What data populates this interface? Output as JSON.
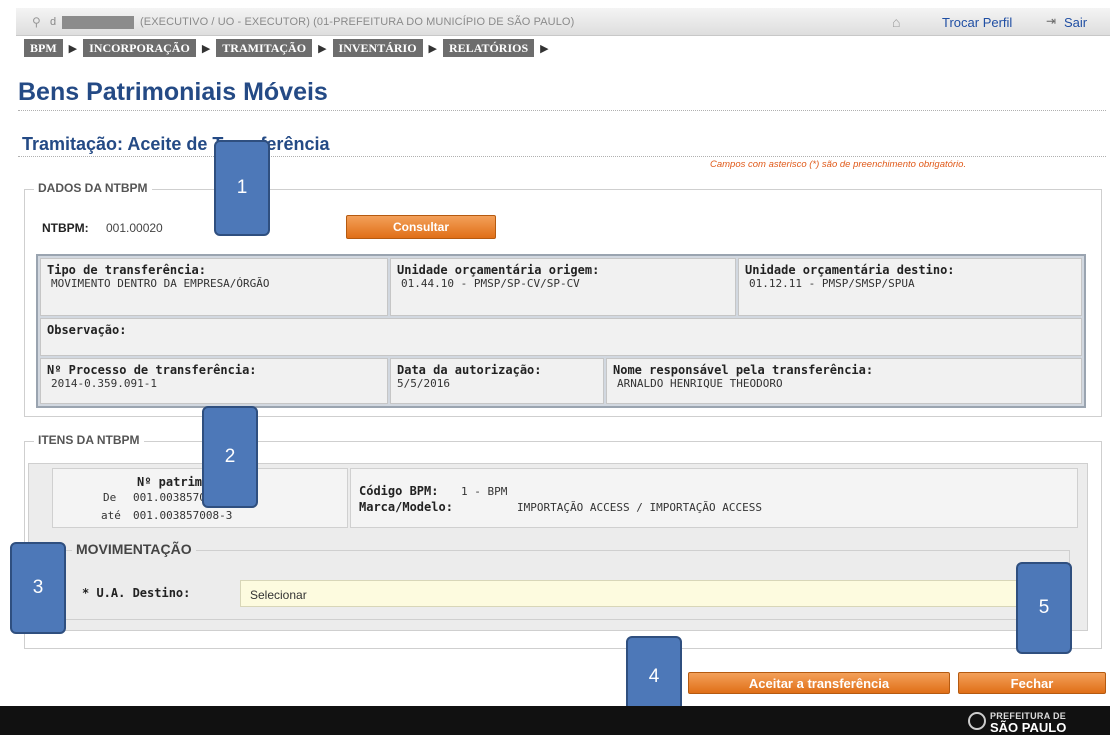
{
  "topbar": {
    "user_name": "d",
    "profile": "(EXECUTIVO / UO - EXECUTOR) (01-PREFEITURA DO MUNICÍPIO DE SÃO PAULO)",
    "switch_profile": "Trocar Perfil",
    "logout": "Sair"
  },
  "nav": {
    "items": [
      "BPM",
      "INCORPORAÇÃO",
      "TRAMITAÇÃO",
      "INVENTÁRIO",
      "RELATÓRIOS"
    ],
    "separator": "▶"
  },
  "page": {
    "title": "Bens Patrimoniais Móveis",
    "section_title": "Tramitação: Aceite de Transferência",
    "required_note": "Campos com asterisco (*) são de preenchimento obrigatório."
  },
  "ntbpm": {
    "legend": "DADOS DA NTBPM",
    "label": "NTBPM:",
    "value": "001.00020",
    "consult_button": "Consultar",
    "transfer_type_label": "Tipo de transferência:",
    "transfer_type_value": "MOVIMENTO DENTRO DA EMPRESA/ÓRGÃO",
    "origin_label": "Unidade orçamentária origem:",
    "origin_value": "01.44.10 - PMSP/SP-CV/SP-CV",
    "destination_label": "Unidade orçamentária destino:",
    "destination_value": "01.12.11 - PMSP/SMSP/SPUA",
    "observation_label": "Observação:",
    "process_label": "Nº Processo de transferência:",
    "process_value": "2014-0.359.091-1",
    "authorization_label": "Data da autorização:",
    "authorization_value": "5/5/2016",
    "responsible_label": "Nome responsável pela transferência:",
    "responsible_value": "ARNALDO HENRIQUE THEODORO"
  },
  "items": {
    "legend": "ITENS DA NTBPM",
    "patrimonial_label": "Nº patrimonial",
    "from_label": "De",
    "from_value": "001.003857008-3",
    "to_label": "até",
    "to_value": "001.003857008-3",
    "bpm_code_label": "Código BPM:",
    "bpm_code_value": "1  -  BPM",
    "brand_label": "Marca/Modelo:",
    "brand_value": "IMPORTAÇÃO ACCESS  /  IMPORTAÇÃO ACCESS"
  },
  "movement": {
    "legend": "MOVIMENTAÇÃO",
    "ua_label": "* U.A. Destino:",
    "ua_value": "Selecionar"
  },
  "actions": {
    "accept": "Aceitar a transferência",
    "close": "Fechar"
  },
  "callouts": [
    "1",
    "2",
    "3",
    "4",
    "5"
  ],
  "footer": {
    "logo_line1": "PREFEITURA DE",
    "logo_line2": "SÃO PAULO"
  },
  "colors": {
    "title_blue": "#244a85",
    "button_orange": "#e06f17",
    "callout_blue": "#4d78b8",
    "link_blue": "#1f4ea3"
  }
}
